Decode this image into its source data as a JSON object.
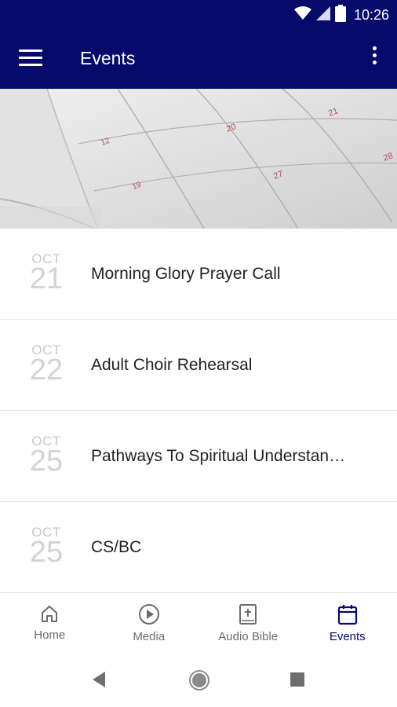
{
  "status_bar": {
    "time": "10:26",
    "icons": [
      "wifi-icon",
      "signal-icon",
      "battery-icon"
    ]
  },
  "app_bar": {
    "title": "Events",
    "menu_icon": "hamburger-menu-icon",
    "overflow_icon": "more-vert-icon",
    "background": "#050a6b"
  },
  "hero": {
    "image": "calendar-photo"
  },
  "events": [
    {
      "month": "OCT",
      "day": "21",
      "title": "Morning Glory Prayer Call"
    },
    {
      "month": "OCT",
      "day": "22",
      "title": "Adult Choir Rehearsal"
    },
    {
      "month": "OCT",
      "day": "25",
      "title": "Pathways To Spiritual Understan…"
    },
    {
      "month": "OCT",
      "day": "25",
      "title": "CS/BC"
    }
  ],
  "bottom_nav": {
    "items": [
      {
        "label": "Home",
        "icon": "home-icon"
      },
      {
        "label": "Media",
        "icon": "play-circle-icon"
      },
      {
        "label": "Audio Bible",
        "icon": "bible-icon"
      },
      {
        "label": "Events",
        "icon": "calendar-icon"
      }
    ],
    "active": "Events",
    "active_color": "#050a6b"
  },
  "system_nav": {
    "icons": [
      "back-icon",
      "home-circle-icon",
      "recents-icon"
    ]
  }
}
